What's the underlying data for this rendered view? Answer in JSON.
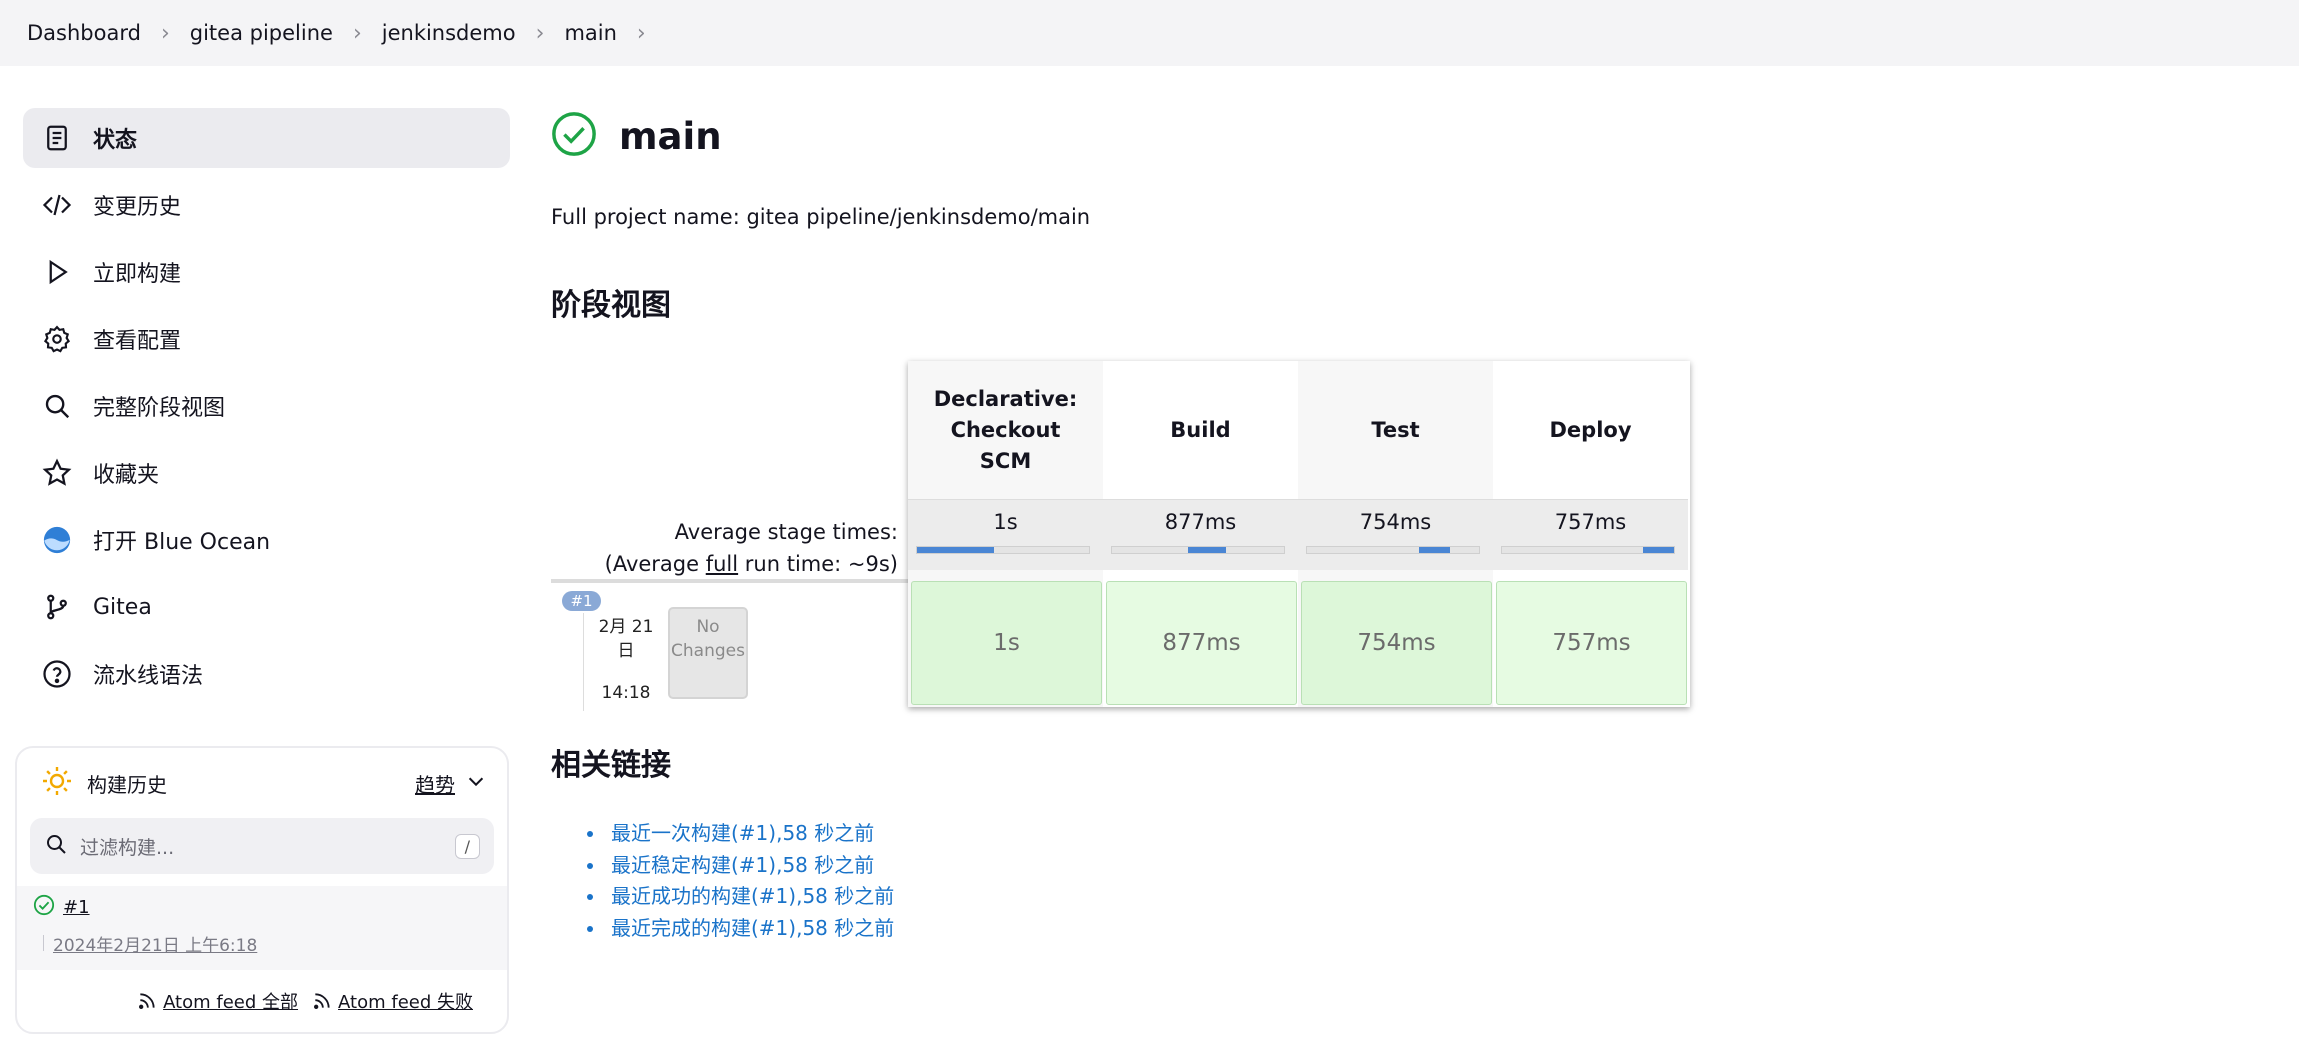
{
  "breadcrumb": [
    "Dashboard",
    "gitea pipeline",
    "jenkinsdemo",
    "main"
  ],
  "sidebar": {
    "items": [
      {
        "label": "状态",
        "icon": "document-icon"
      },
      {
        "label": "变更历史",
        "icon": "code-icon"
      },
      {
        "label": "立即构建",
        "icon": "play-icon"
      },
      {
        "label": "查看配置",
        "icon": "gear-icon"
      },
      {
        "label": "完整阶段视图",
        "icon": "search-icon"
      },
      {
        "label": "收藏夹",
        "icon": "star-icon"
      },
      {
        "label": "打开 Blue Ocean",
        "icon": "blue-ocean-icon"
      },
      {
        "label": "Gitea",
        "icon": "git-branch-icon"
      },
      {
        "label": "流水线语法",
        "icon": "help-circle-icon"
      }
    ]
  },
  "history": {
    "title": "构建历史",
    "trend": "趋势",
    "filter_placeholder": "过滤构建...",
    "filter_shortcut": "/",
    "build": {
      "number": "#1",
      "date": "2024年2月21日 上午6:18"
    },
    "feeds": [
      "Atom feed 全部",
      "Atom feed 失败"
    ]
  },
  "main": {
    "title": "main",
    "project_name": "Full project name: gitea pipeline/jenkinsdemo/main",
    "stage_heading": "阶段视图",
    "avg_stage_label": "Average stage times:",
    "avg_run_prefix": "(Average ",
    "avg_run_link": "full",
    "avg_run_suffix": " run time: ~9s)",
    "run": {
      "badge": "#1",
      "date_line1": "2月 21",
      "date_line2": "日",
      "time": "14:18",
      "changes_line1": "No",
      "changes_line2": "Changes"
    },
    "stages": [
      {
        "name_line1": "Declarative:",
        "name_line2": "Checkout",
        "name_line3": "SCM",
        "avg": "1s",
        "cell": "1s",
        "bar_start": 0.0,
        "bar_fraction": 0.45
      },
      {
        "name_line1": "Build",
        "avg": "877ms",
        "cell": "877ms",
        "bar_start": 0.44,
        "bar_fraction": 0.22
      },
      {
        "name_line1": "Test",
        "avg": "754ms",
        "cell": "754ms",
        "bar_start": 0.65,
        "bar_fraction": 0.18
      },
      {
        "name_line1": "Deploy",
        "avg": "757ms",
        "cell": "757ms",
        "bar_start": 0.82,
        "bar_fraction": 0.18
      }
    ],
    "links_heading": "相关链接",
    "links": [
      "最近一次构建(#1),58 秒之前",
      "最近稳定构建(#1),58 秒之前",
      "最近成功的构建(#1),58 秒之前",
      "最近完成的构建(#1),58 秒之前"
    ]
  },
  "colors": {
    "success_green": "#1ea446",
    "link_blue": "#1a73c9",
    "progress_blue": "#4a86d4",
    "cell_green": "#ddf7d9",
    "cell_green_alt": "#e6fbe2"
  }
}
